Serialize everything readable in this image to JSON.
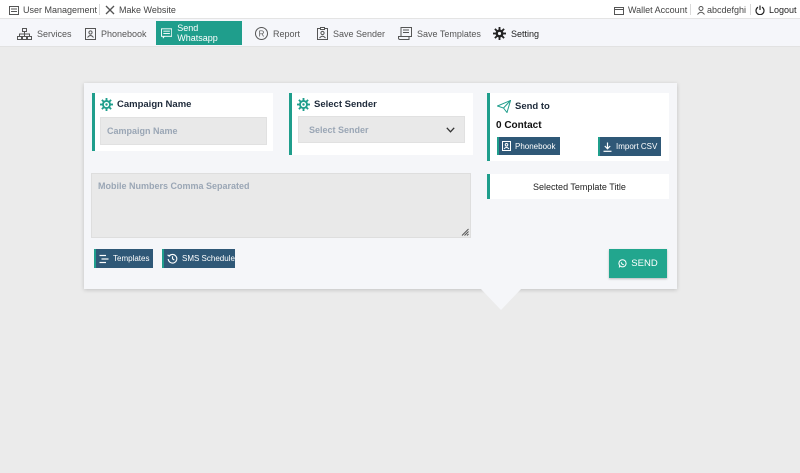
{
  "topbar": {
    "user_management": "User Management",
    "make_website": "Make Website",
    "wallet_account": "Wallet Account",
    "username": "abcdefghi",
    "logout": "Logout"
  },
  "nav": {
    "services": "Services",
    "phonebook": "Phonebook",
    "send_whatsapp": "Send Whatsapp",
    "report": "Report",
    "save_sender": "Save Sender",
    "save_templates": "Save Templates",
    "setting": "Setting"
  },
  "campaign": {
    "title": "Campaign Name",
    "placeholder": "Campaign Name"
  },
  "sender": {
    "title": "Select Sender",
    "selected": "Select Sender"
  },
  "send_to": {
    "title": "Send to",
    "contacts": "0 Contact",
    "phonebook_button": "Phonebook",
    "import_button": "Import CSV"
  },
  "numbers": {
    "placeholder": "Mobile Numbers Comma Separated"
  },
  "template_title": "Selected Template Title",
  "buttons": {
    "templates": "Templates",
    "sms_schedule": "SMS Schedule",
    "send": "SEND"
  },
  "colors": {
    "accent": "#1f9e8c",
    "dark_button": "#2f5877",
    "send_button": "#22a68e",
    "background": "#ebebeb"
  }
}
